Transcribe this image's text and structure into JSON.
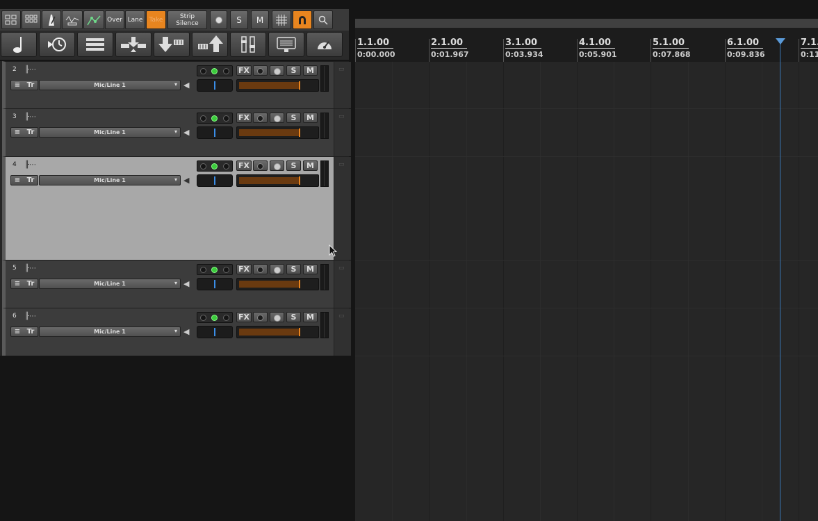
{
  "toolbar": {
    "over_label": "Over",
    "lane_label": "Lane",
    "take_label": "Take",
    "strip_label_1": "Strip",
    "strip_label_2": "Silence",
    "solo_label": "S",
    "mute_label": "M",
    "accent_color": "#e8851f"
  },
  "tracks": [
    {
      "number": "2",
      "menu": "≡",
      "tr": "Tr",
      "input": "Mic/Line 1",
      "fx": "FX",
      "solo": "S",
      "mute": "M"
    },
    {
      "number": "3",
      "menu": "≡",
      "tr": "Tr",
      "input": "Mic/Line 1",
      "fx": "FX",
      "solo": "S",
      "mute": "M"
    },
    {
      "number": "4",
      "menu": "≡",
      "tr": "Tr",
      "input": "Mic/Line 1",
      "fx": "FX",
      "solo": "S",
      "mute": "M"
    },
    {
      "number": "5",
      "menu": "≡",
      "tr": "Tr",
      "input": "Mic/Line 1",
      "fx": "FX",
      "solo": "S",
      "mute": "M"
    },
    {
      "number": "6",
      "menu": "≡",
      "tr": "Tr",
      "input": "Mic/Line 1",
      "fx": "FX",
      "solo": "S",
      "mute": "M"
    }
  ],
  "ruler": {
    "bars": [
      "1.1.00",
      "2.1.00",
      "3.1.00",
      "4.1.00",
      "5.1.00",
      "6.1.00",
      "7.1."
    ],
    "times": [
      "0:00.000",
      "0:01.967",
      "0:03.934",
      "0:05.901",
      "0:07.868",
      "0:09.836",
      "0:11"
    ]
  },
  "colors": {
    "cursor": "#3a78b8",
    "selected_track": "#a8a8a8"
  }
}
